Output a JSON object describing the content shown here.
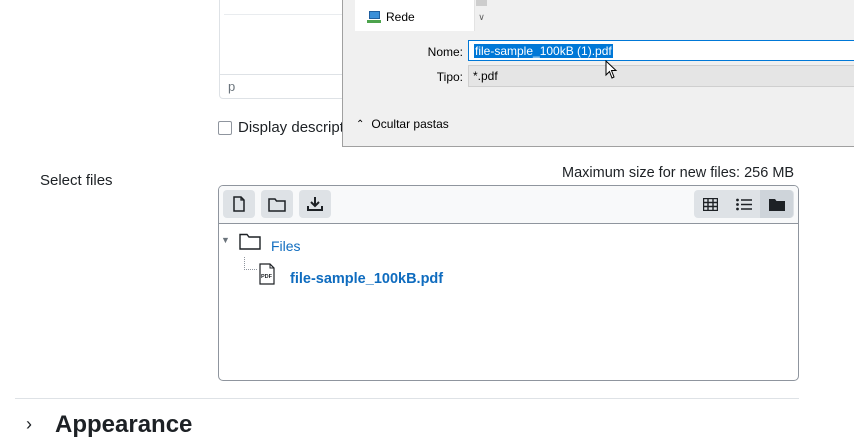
{
  "editor": {
    "path_label": "p",
    "display_description_label": "Display descript"
  },
  "save_dialog": {
    "nav_item": "Rede",
    "name_label": "Nome:",
    "name_value": "file-sample_100kB (1).pdf",
    "type_label": "Tipo:",
    "type_value": "*.pdf",
    "toggle_folders_label": "Ocultar pastas"
  },
  "file_picker": {
    "label": "Select files",
    "max_size": "Maximum size for new files: 256 MB",
    "root_folder": "Files",
    "files": [
      {
        "name": "file-sample_100kB.pdf",
        "type_badge": "PDF"
      }
    ]
  },
  "section": {
    "title": "Appearance"
  },
  "colors": {
    "link": "#0f6cbf",
    "selection": "#0078d7",
    "border": "#8f959e"
  }
}
